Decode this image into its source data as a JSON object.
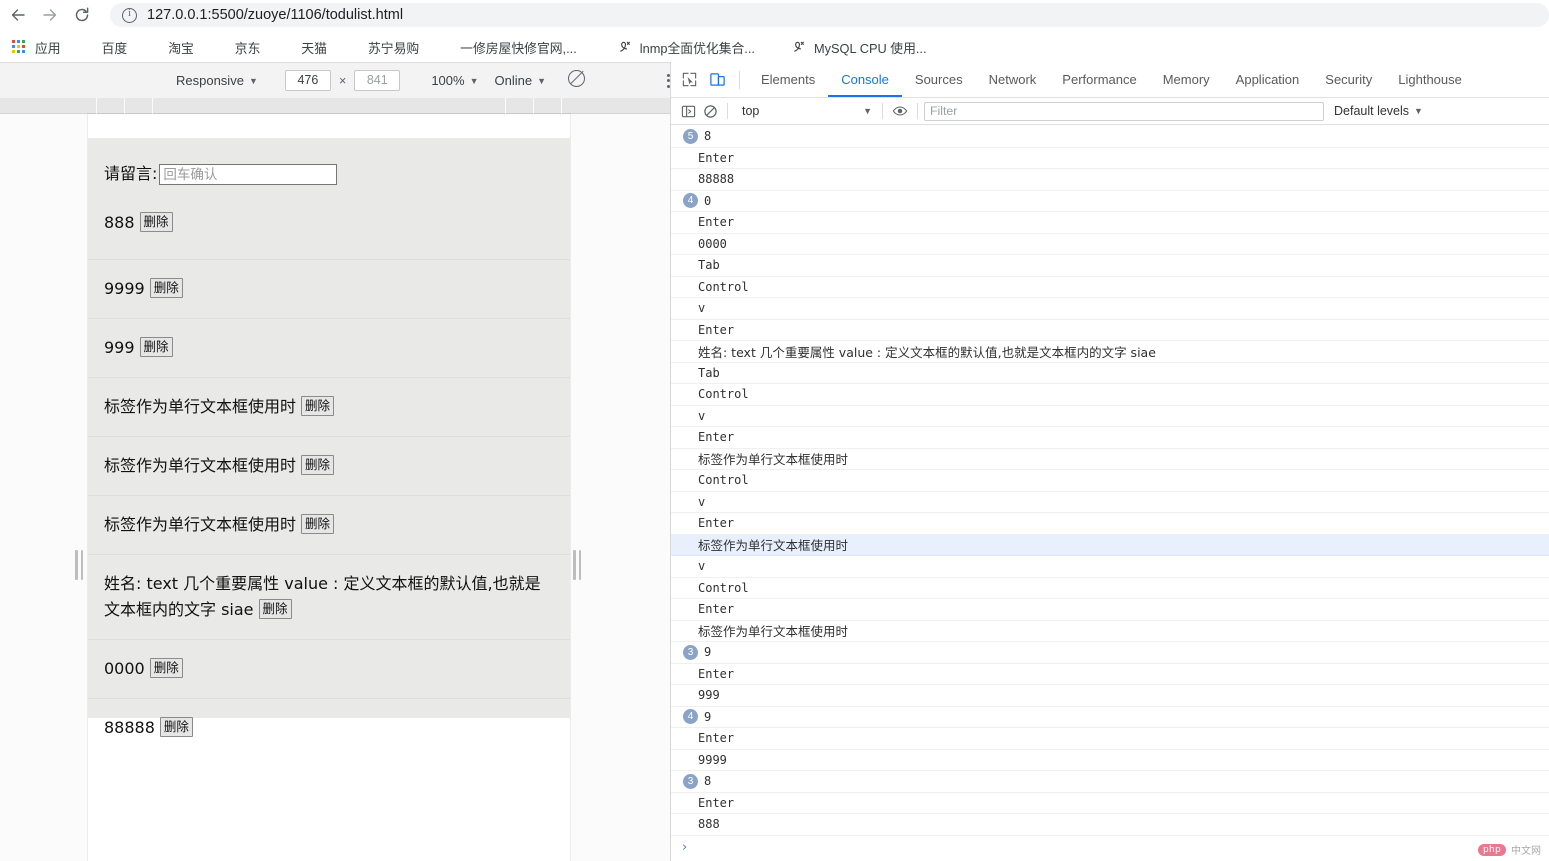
{
  "browser": {
    "back_label": "back-arrow",
    "forward_label": "forward-arrow",
    "reload_label": "reload",
    "url": "127.0.0.1:5500/zuoye/1106/todulist.html",
    "bookmarks": [
      {
        "label": "应用",
        "icon": "apps-grid-icon"
      },
      {
        "label": "百度",
        "icon": "baidu-icon"
      },
      {
        "label": "淘宝",
        "icon": "globe-icon"
      },
      {
        "label": "京东",
        "icon": "globe-icon"
      },
      {
        "label": "天猫",
        "icon": "globe-icon"
      },
      {
        "label": "苏宁易购",
        "icon": "globe-icon"
      },
      {
        "label": "一修房屋快修官网,...",
        "icon": "green-home-icon"
      },
      {
        "label": "lnmp全面优化集合...",
        "icon": "lnmp-icon"
      },
      {
        "label": "MySQL CPU 使用...",
        "icon": "lnmp-icon"
      }
    ]
  },
  "device_toolbar": {
    "device": "Responsive",
    "width": "476",
    "height": "841",
    "height_placeholder": "841",
    "zoom": "100%",
    "throttling": "Online",
    "throttle_icon": "no-throttling-icon",
    "more_icon": "kebab-menu-icon"
  },
  "page": {
    "message_label": "请留言:",
    "message_placeholder": "回车确认",
    "message_value": "",
    "delete_label": "删除",
    "todos": [
      "888",
      "9999",
      "999",
      "标签作为单行文本框使用时",
      "标签作为单行文本框使用时",
      "标签作为单行文本框使用时",
      "姓名: text 几个重要属性 value : 定义文本框的默认值,也就是文本框内的文字 siae",
      "0000",
      "88888"
    ]
  },
  "devtools": {
    "inspect_icon": "inspect-element-icon",
    "device_toggle_icon": "device-toolbar-icon",
    "tabs": [
      {
        "label": "Elements",
        "active": false
      },
      {
        "label": "Console",
        "active": true
      },
      {
        "label": "Sources",
        "active": false
      },
      {
        "label": "Network",
        "active": false
      },
      {
        "label": "Performance",
        "active": false
      },
      {
        "label": "Memory",
        "active": false
      },
      {
        "label": "Application",
        "active": false
      },
      {
        "label": "Security",
        "active": false
      },
      {
        "label": "Lighthouse",
        "active": false
      }
    ],
    "filterbar": {
      "sidebar_icon": "show-console-sidebar-icon",
      "clear_icon": "clear-console-icon",
      "context": "top",
      "eye_icon": "live-expressions-eye-icon",
      "filter_placeholder": "Filter",
      "filter_value": "",
      "levels": "Default levels"
    },
    "prompt_chevron": "›",
    "console_rows": [
      {
        "count": "5",
        "text": "8",
        "cn": false,
        "selected": false
      },
      {
        "count": "",
        "text": "Enter",
        "cn": false,
        "selected": false
      },
      {
        "count": "",
        "text": "88888",
        "cn": false,
        "selected": false
      },
      {
        "count": "4",
        "text": "0",
        "cn": false,
        "selected": false
      },
      {
        "count": "",
        "text": "Enter",
        "cn": false,
        "selected": false
      },
      {
        "count": "",
        "text": "0000",
        "cn": false,
        "selected": false
      },
      {
        "count": "",
        "text": "Tab",
        "cn": false,
        "selected": false
      },
      {
        "count": "",
        "text": "Control",
        "cn": false,
        "selected": false
      },
      {
        "count": "",
        "text": "v",
        "cn": false,
        "selected": false
      },
      {
        "count": "",
        "text": "Enter",
        "cn": false,
        "selected": false
      },
      {
        "count": "",
        "text": "姓名: text 几个重要属性 value : 定义文本框的默认值,也就是文本框内的文字 siae",
        "cn": true,
        "selected": false
      },
      {
        "count": "",
        "text": "Tab",
        "cn": false,
        "selected": false
      },
      {
        "count": "",
        "text": "Control",
        "cn": false,
        "selected": false
      },
      {
        "count": "",
        "text": "v",
        "cn": false,
        "selected": false
      },
      {
        "count": "",
        "text": "Enter",
        "cn": false,
        "selected": false
      },
      {
        "count": "",
        "text": "标签作为单行文本框使用时",
        "cn": true,
        "selected": false
      },
      {
        "count": "",
        "text": "Control",
        "cn": false,
        "selected": false
      },
      {
        "count": "",
        "text": "v",
        "cn": false,
        "selected": false
      },
      {
        "count": "",
        "text": "Enter",
        "cn": false,
        "selected": false
      },
      {
        "count": "",
        "text": "标签作为单行文本框使用时",
        "cn": true,
        "selected": true
      },
      {
        "count": "",
        "text": "v",
        "cn": false,
        "selected": false
      },
      {
        "count": "",
        "text": "Control",
        "cn": false,
        "selected": false
      },
      {
        "count": "",
        "text": "Enter",
        "cn": false,
        "selected": false
      },
      {
        "count": "",
        "text": "标签作为单行文本框使用时",
        "cn": true,
        "selected": false
      },
      {
        "count": "3",
        "text": "9",
        "cn": false,
        "selected": false
      },
      {
        "count": "",
        "text": "Enter",
        "cn": false,
        "selected": false
      },
      {
        "count": "",
        "text": "999",
        "cn": false,
        "selected": false
      },
      {
        "count": "4",
        "text": "9",
        "cn": false,
        "selected": false
      },
      {
        "count": "",
        "text": "Enter",
        "cn": false,
        "selected": false
      },
      {
        "count": "",
        "text": "9999",
        "cn": false,
        "selected": false
      },
      {
        "count": "3",
        "text": "8",
        "cn": false,
        "selected": false
      },
      {
        "count": "",
        "text": "Enter",
        "cn": false,
        "selected": false
      },
      {
        "count": "",
        "text": "888",
        "cn": false,
        "selected": false
      }
    ]
  },
  "watermark": {
    "logo": "php",
    "text": "中文网"
  },
  "colors": {
    "accent": "#1a73e8",
    "badge": "#8ba3c7",
    "selection": "#e8f0fe",
    "page_bg": "#e9e9e7"
  }
}
